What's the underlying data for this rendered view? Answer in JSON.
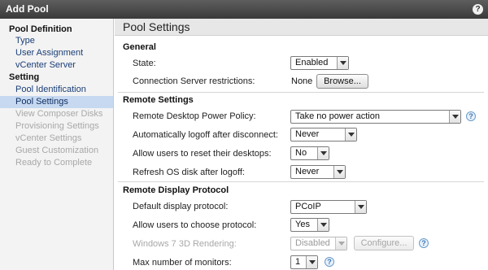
{
  "window": {
    "title": "Add Pool",
    "help_glyph": "?"
  },
  "sidebar": {
    "section1": "Pool Definition",
    "section1_items": [
      "Type",
      "User Assignment",
      "vCenter Server"
    ],
    "section2": "Setting",
    "section2_items": [
      "Pool Identification",
      "Pool Settings",
      "View Composer Disks",
      "Provisioning Settings",
      "vCenter Settings",
      "Guest Customization",
      "Ready to Complete"
    ],
    "active_item": "Pool Settings"
  },
  "content": {
    "title": "Pool Settings",
    "general": {
      "title": "General",
      "state_label": "State:",
      "state_value": "Enabled",
      "conn_label": "Connection Server restrictions:",
      "conn_value": "None",
      "browse_label": "Browse..."
    },
    "remote_settings": {
      "title": "Remote Settings",
      "power_label": "Remote Desktop Power Policy:",
      "power_value": "Take no power action",
      "logoff_label": "Automatically logoff after disconnect:",
      "logoff_value": "Never",
      "reset_label": "Allow users to reset their desktops:",
      "reset_value": "No",
      "refresh_label": "Refresh OS disk after logoff:",
      "refresh_value": "Never"
    },
    "display": {
      "title": "Remote Display Protocol",
      "protocol_label": "Default display protocol:",
      "protocol_value": "PCoIP",
      "choose_label": "Allow users to choose protocol:",
      "choose_value": "Yes",
      "rendering_label": "Windows 7 3D Rendering:",
      "rendering_value": "Disabled",
      "configure_label": "Configure...",
      "monitors_label": "Max number of monitors:",
      "monitors_value": "1"
    }
  },
  "colors": {
    "accent_selected": "#c6d9f1",
    "titlebar": "#4a4a4a",
    "link": "#1a3e78"
  }
}
